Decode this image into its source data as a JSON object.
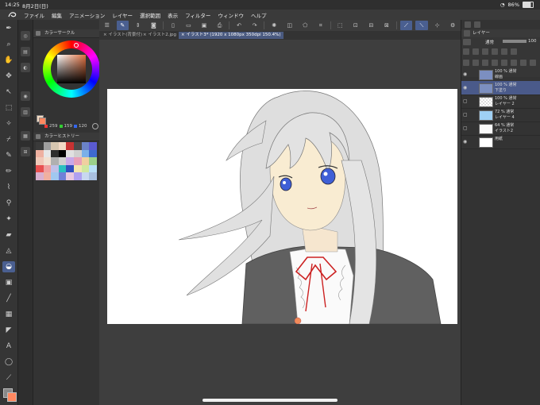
{
  "status": {
    "time": "14:25",
    "date": "8月2日(日)",
    "battery": "86%"
  },
  "menu": [
    "ファイル",
    "編集",
    "アニメーション",
    "レイヤー",
    "選択範囲",
    "表示",
    "フィルター",
    "ウィンドウ",
    "ヘルプ"
  ],
  "tabs": [
    {
      "label": "× イラスト(背景付)",
      "active": false
    },
    {
      "label": "× イラスト2.jpg",
      "active": false
    },
    {
      "label": "× イラスト3* (1920 x 1080px 350dpi 150.4%)",
      "active": true
    }
  ],
  "left": {
    "color_circle_title": "カラーサークル",
    "rgb": {
      "r": "259",
      "g": "159",
      "b": "120"
    },
    "history_title": "カラーヒストリー",
    "history_colors": [
      "#3a3a3a",
      "#9e9e9e",
      "#d6c6b0",
      "#f2d8c4",
      "#c83232",
      "#4a4a4a",
      "#6a82c8",
      "#5a5ad0",
      "#eeb0a0",
      "#e6e6e6",
      "#2e2e2e",
      "#000000",
      "#e0e0e0",
      "#cfcfcf",
      "#7ab0e8",
      "#3d6ad0",
      "#f0c8b8",
      "#f2e0d0",
      "#b0b0b0",
      "#d0d0d0",
      "#c8a8e8",
      "#e8a0b8",
      "#f0d0a0",
      "#9ad08a",
      "#e85050",
      "#f0a0a0",
      "#c0c0e8",
      "#2ac0c0",
      "#3050c0",
      "#f2e6b0",
      "#d0e8a0",
      "#b8e0f8",
      "#d8b0d0",
      "#f0b0a0",
      "#a0c8f0",
      "#7080d8",
      "#e8c8e0",
      "#b0a0f0",
      "#c8d8f0",
      "#a8c0e0"
    ]
  },
  "right": {
    "panel_title": "レイヤー",
    "blend_mode": "通常",
    "opacity": "100",
    "layers": [
      {
        "line1": "100 % 通常",
        "line2": "線画",
        "type": "folder",
        "selected": false,
        "visible": true
      },
      {
        "line1": "100 % 通常",
        "line2": "下塗り",
        "type": "folder",
        "selected": true,
        "visible": true
      },
      {
        "line1": "100 % 通常",
        "line2": "レイヤー 2",
        "type": "raster",
        "selected": false,
        "visible": false
      },
      {
        "line1": "72 % 通常",
        "line2": "レイヤー 4",
        "type": "blue",
        "selected": false,
        "visible": false
      },
      {
        "line1": "64 % 通常",
        "line2": "イラスト2",
        "type": "image",
        "selected": false,
        "visible": false
      },
      {
        "line1": "",
        "line2": "用紙",
        "type": "paper",
        "selected": false,
        "visible": true
      }
    ]
  },
  "colors": {
    "accent": "#4a5f90",
    "canvas_bg": "#3e3e3e"
  }
}
